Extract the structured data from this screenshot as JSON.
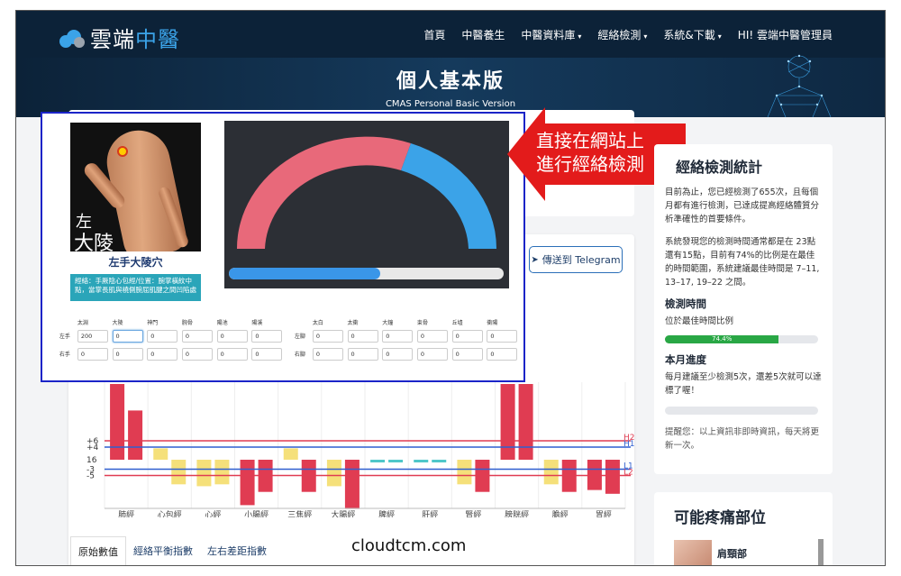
{
  "nav": {
    "logo_main": "雲端",
    "logo_accent": "中醫",
    "links": [
      {
        "label": "首頁",
        "caret": false
      },
      {
        "label": "中醫養生",
        "caret": false
      },
      {
        "label": "中醫資料庫",
        "caret": true
      },
      {
        "label": "經絡檢測",
        "caret": true
      },
      {
        "label": "系統&下載",
        "caret": true
      },
      {
        "label": "HI! 雲端中醫管理員",
        "caret": false
      }
    ]
  },
  "hero": {
    "title": "個人基本版",
    "subtitle": "CMAS Personal Basic Version"
  },
  "callout": {
    "line1": "直接在網站上",
    "line2": "進行經絡檢測"
  },
  "acupoint": {
    "side": "左",
    "name_image": "大陵",
    "title": "左手大陵穴",
    "info": "經絡：手厥陰心包經/位置：腕掌橫紋中點，當掌長肌與橈側腕屈肌腱之間凹陷處"
  },
  "gauge": {
    "progress": 0.55,
    "colors": {
      "left": "#e8697a",
      "right": "#3ba3e8",
      "track": "#e8e8e8"
    }
  },
  "readings": {
    "hand_points": [
      "太淵",
      "大陵",
      "神門",
      "腕骨",
      "陽池",
      "陽溪"
    ],
    "foot_points": [
      "太白",
      "太衝",
      "大鐘",
      "束骨",
      "丘墟",
      "衝陽"
    ],
    "hand_rows": [
      {
        "label": "左手",
        "values": [
          "200",
          "0",
          "0",
          "0",
          "0",
          "0"
        ]
      },
      {
        "label": "右手",
        "values": [
          "0",
          "0",
          "0",
          "0",
          "0",
          "0"
        ]
      }
    ],
    "foot_rows": [
      {
        "label": "左腳",
        "values": [
          "0",
          "0",
          "0",
          "0",
          "0",
          "0"
        ]
      },
      {
        "label": "右腳",
        "values": [
          "0",
          "0",
          "0",
          "0",
          "0",
          "0"
        ]
      }
    ]
  },
  "telegram_button": "傳送到 Telegram",
  "chart_data": {
    "type": "bar",
    "categories": [
      "肺經",
      "心包經",
      "心經",
      "小腸經",
      "三焦經",
      "大腸經",
      "脾經",
      "肝經",
      "腎經",
      "膀胱經",
      "膽經",
      "胃經"
    ],
    "series": [
      {
        "values": [
          40,
          6,
          -14,
          -24,
          6,
          -14,
          -1,
          -1,
          -13,
          40,
          -13,
          -16
        ]
      },
      {
        "values": [
          26,
          -13,
          -13,
          -17,
          -17,
          -26,
          -1,
          -1,
          -17,
          40,
          -17,
          -18
        ]
      }
    ],
    "series_colors": [
      "#e03c52",
      "#f5e07a",
      "#4fc7c9"
    ],
    "ref_lines": [
      {
        "label": "H2",
        "value": 6,
        "color": "#e03c52"
      },
      {
        "label": "H1",
        "value": 4,
        "color": "#2f5fd0"
      },
      {
        "label": "L1",
        "value": -3,
        "color": "#2f5fd0"
      },
      {
        "label": "L2",
        "value": -5,
        "color": "#e03c52"
      }
    ],
    "ytick_labels": [
      "+6",
      "+4",
      "16",
      "-3",
      "-5"
    ]
  },
  "tabs": [
    "原始數值",
    "經絡平衡指數",
    "左右差距指數"
  ],
  "watermark": "cloudtcm.com",
  "stats": {
    "title": "經絡檢測統計",
    "p1": "目前為止，您已經檢測了655次，且每個月都有進行檢測，已達成提高經絡體質分析準確性的首要條件。",
    "p2": "系統發現您的檢測時間通常都是在 23點還有15點，目前有74%的比例是在最佳的時間範圍，系統建議最佳時間是 7–11, 13–17, 19–22 之間。",
    "time_heading": "檢測時間",
    "time_caption": "位於最佳時間比例",
    "time_pct": 0.744,
    "time_pct_label": "74.4%",
    "month_heading": "本月進度",
    "month_text": "每月建議至少檢測5次，還差5次就可以達標了喔！",
    "month_progress": 0,
    "note": "提醒您：以上資訊非即時資訊，每天將更新一次。"
  },
  "pain": {
    "title": "可能疼痛部位",
    "first_item": "肩頸部"
  }
}
